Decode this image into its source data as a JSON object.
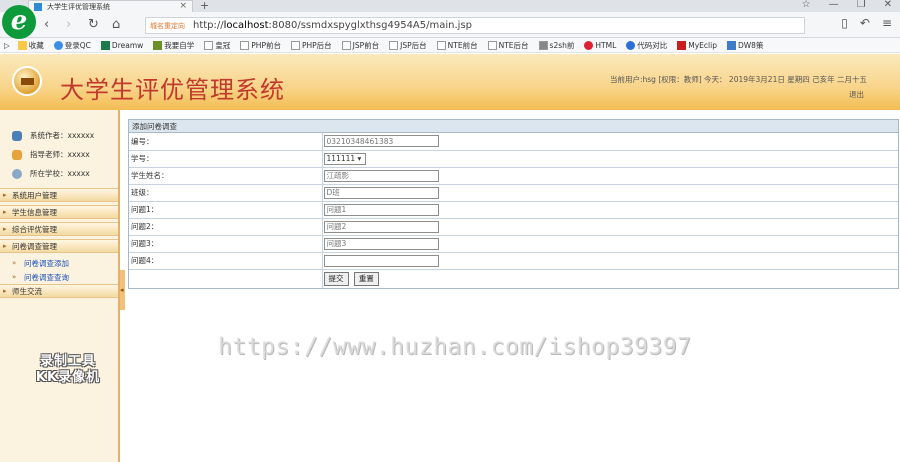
{
  "browser": {
    "tab_title": "大学生评优管理系统",
    "tab_close": "×",
    "new_tab": "+",
    "url_tag": "城名重定向",
    "url_prefix": "http://",
    "url_host": "localhost",
    "url_rest": ":8080/ssmdxspyglxthsg4954A5/main.jsp",
    "bookmarks": [
      {
        "label": "收藏",
        "icon": "star-icon"
      },
      {
        "label": "登录QC",
        "icon": "globe-icon"
      },
      {
        "label": "Dreamw",
        "icon": "dreamweaver-icon"
      },
      {
        "label": "我要自学",
        "icon": "book-icon"
      },
      {
        "label": "皇冠",
        "icon": "page-icon"
      },
      {
        "label": "PHP前台",
        "icon": "page-icon"
      },
      {
        "label": "PHP后台",
        "icon": "page-icon"
      },
      {
        "label": "JSP前台",
        "icon": "page-icon"
      },
      {
        "label": "JSP后台",
        "icon": "page-icon"
      },
      {
        "label": "NTE前台",
        "icon": "page-icon"
      },
      {
        "label": "NTE后台",
        "icon": "page-icon"
      },
      {
        "label": "s2sh前",
        "icon": "image-icon"
      },
      {
        "label": "HTML",
        "icon": "html-icon"
      },
      {
        "label": "代码对比",
        "icon": "compare-icon"
      },
      {
        "label": "MyEclip",
        "icon": "myeclipse-icon"
      },
      {
        "label": "DW8策",
        "icon": "dw-icon"
      }
    ],
    "colors": {
      "accent": "#0c9a3a",
      "url_tag": "#e8762d"
    }
  },
  "header": {
    "title": "大学生评优管理系统",
    "user_info": "当前用户:hsg [权限：教师]  今天：  2019年3月21日  星期四  己亥年  二月十五",
    "logout": "退出"
  },
  "sidebar": {
    "info": [
      {
        "label": "系统作者：xxxxxx",
        "icon": "author-icon"
      },
      {
        "label": "指导老师：xxxxx",
        "icon": "teacher-icon"
      },
      {
        "label": "所在学校：xxxxx",
        "icon": "school-icon"
      }
    ],
    "menus": [
      {
        "label": "系统用户管理"
      },
      {
        "label": "学生信息管理"
      },
      {
        "label": "综合评优管理"
      },
      {
        "label": "问卷调查管理",
        "subitems": [
          "问卷调查添加",
          "问卷调查查询"
        ]
      },
      {
        "label": "师生交流"
      }
    ],
    "watermark_logo": [
      "录制工具",
      "KK录像机"
    ]
  },
  "form": {
    "heading": "添加问卷调查",
    "rows": [
      {
        "label": "编号：",
        "value": "03210348461383",
        "kind": "input"
      },
      {
        "label": "学号：",
        "value": "111111",
        "kind": "select"
      },
      {
        "label": "学生姓名：",
        "value": "江疏影",
        "kind": "input"
      },
      {
        "label": "班级：",
        "value": "D班",
        "kind": "input"
      },
      {
        "label": "问题1：",
        "value": "问题1",
        "kind": "input"
      },
      {
        "label": "问题2：",
        "value": "问题2",
        "kind": "input"
      },
      {
        "label": "问题3：",
        "value": "问题3",
        "kind": "input"
      },
      {
        "label": "问题4：",
        "value": "",
        "kind": "input"
      }
    ],
    "submit_label": "提交",
    "reset_label": "重置"
  },
  "watermark": "https://www.huzhan.com/ishop39397"
}
